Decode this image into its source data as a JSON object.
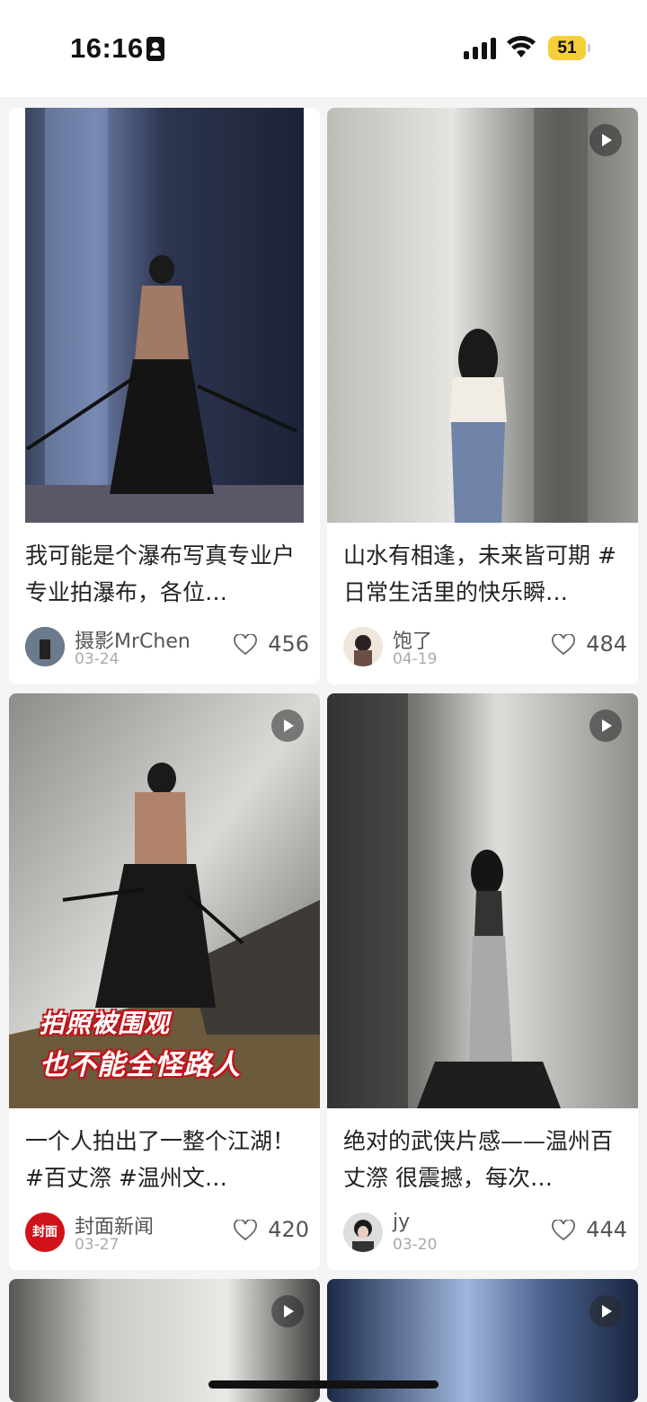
{
  "status_bar": {
    "time": "16:16",
    "battery_level": "51",
    "battery_color": "#f5cf3a",
    "icons": [
      "id-card-icon",
      "cellular-signal-icon",
      "wifi-icon",
      "battery-icon"
    ]
  },
  "feed": {
    "cards": [
      {
        "title": "我可能是个瀑布写真专业户 专业拍瀑布，各位…",
        "author": "摄影MrChen",
        "date": "03-24",
        "likes": "456",
        "is_video": false
      },
      {
        "title": "山水有相逢，未来皆可期 #日常生活里的快乐瞬…",
        "author": "饱了",
        "date": "04-19",
        "likes": "484",
        "is_video": true
      },
      {
        "title": "一个人拍出了一整个江湖！ #百丈漈 #温州文…",
        "author": "封面新闻",
        "date": "03-27",
        "likes": "420",
        "is_video": true,
        "overlay_line1": "拍照被围观",
        "overlay_line2": "也不能全怪路人",
        "avatar_text": "封面",
        "avatar_color": "#d0121b"
      },
      {
        "title": "绝对的武侠片感——温州百丈漈 很震撼，每次…",
        "author": "jy",
        "date": "03-20",
        "likes": "444",
        "is_video": true
      },
      {
        "is_video": true
      },
      {
        "is_video": true
      }
    ]
  }
}
